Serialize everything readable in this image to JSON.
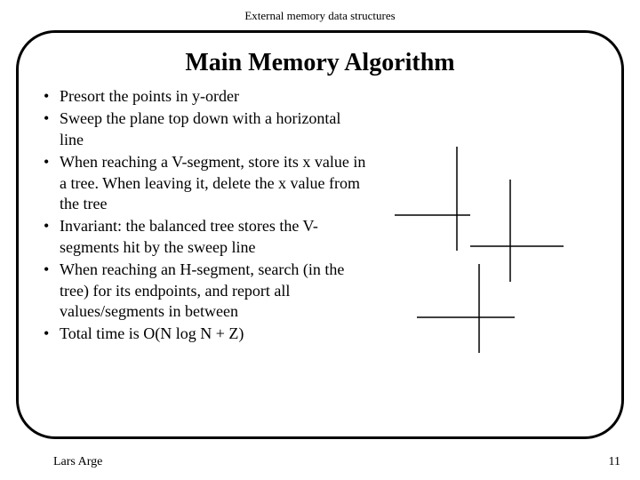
{
  "header": "External memory data structures",
  "title": "Main Memory Algorithm",
  "bullets": [
    "Presort the points in y-order",
    "Sweep the plane top down with a horizontal line",
    "When reaching a V-segment, store its x value in a tree. When leaving it, delete the x value from the tree",
    "Invariant: the balanced tree stores the V-segments hit by the sweep line",
    "When reaching an H-segment, search (in the tree) for its endpoints, and report all values/segments in between",
    "Total time is O(N log N + Z)"
  ],
  "footer": {
    "author": "Lars Arge",
    "page": "11"
  }
}
